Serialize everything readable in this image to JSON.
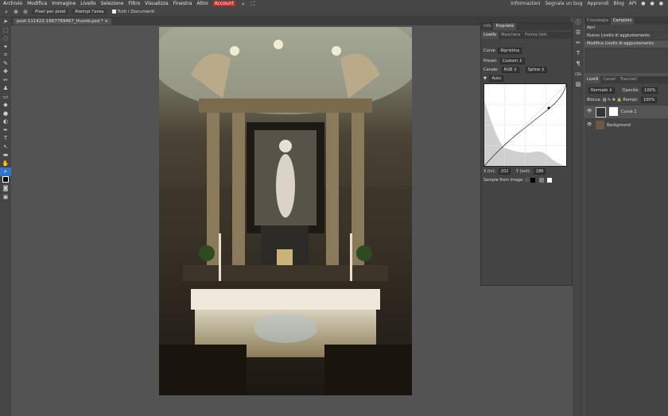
{
  "menubar": {
    "items": [
      "Archivio",
      "Modifica",
      "Immagine",
      "Livello",
      "Selezione",
      "Filtro",
      "Visualizza",
      "Finestra",
      "Altro",
      "Account"
    ],
    "right_links": [
      "Informazioni",
      "Segnala un bug",
      "Apprendi",
      "Blog",
      "API"
    ]
  },
  "options": {
    "pixel_label": "Pixel per pixel",
    "fill_label": "Riempi l'area",
    "all_docs_label": "Tutti i Documenti"
  },
  "document": {
    "tab_title": "post-111422-1667769467_thumb.psd *"
  },
  "properties": {
    "tabs": [
      "Info",
      "Proprietà"
    ],
    "subtabs": [
      "Livello",
      "Maschera",
      "Forma Vett."
    ],
    "curve_label": "Curve",
    "reset_label": "Ripristina",
    "preset_label": "Preset:",
    "preset_value": "Custom",
    "channel_label": "Canale:",
    "channel_value": "RGB",
    "interp_value": "Spline",
    "auto_label": "Auto",
    "x_label": "X (in):",
    "x_value": "202",
    "y_label": "Y (out):",
    "y_value": "186",
    "sample_label": "Sample from image:"
  },
  "history": {
    "tabs": [
      "Cronologia",
      "Campioni"
    ],
    "items": [
      "Apri",
      "Nuovo Livello di aggiustamento",
      "Modifica Livello di aggiustamento"
    ]
  },
  "layers": {
    "tabs": [
      "Livelli",
      "Canali",
      "Tracciati"
    ],
    "blend_mode": "Normale",
    "opacity_label": "Opacità:",
    "opacity_value": "100%",
    "lock_label": "Blocca:",
    "fill_label": "Riempi:",
    "fill_value": "100%",
    "items": [
      {
        "name": "Curve 1"
      },
      {
        "name": "Background"
      }
    ]
  },
  "colors": {
    "accent": "#2d79c7",
    "account": "#d32424"
  }
}
